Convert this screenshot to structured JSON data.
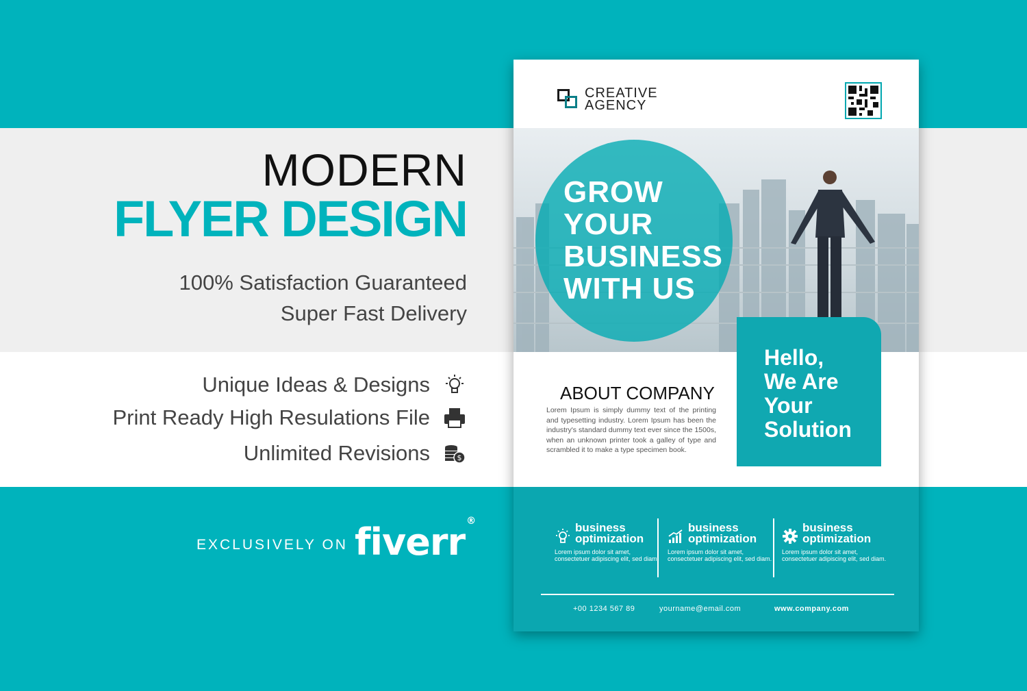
{
  "headline": {
    "line1": "MODERN",
    "line2": "FLYER DESIGN",
    "sub1": "100% Satisfaction Guaranteed",
    "sub2": "Super Fast Delivery"
  },
  "features": [
    {
      "label": "Unique Ideas & Designs",
      "icon": "lightbulb-icon"
    },
    {
      "label": "Print Ready High Resulations File",
      "icon": "printer-icon"
    },
    {
      "label": "Unlimited Revisions",
      "icon": "coins-icon"
    }
  ],
  "exclusive": {
    "label": "EXCLUSIVELY ON",
    "brand": "fiverr",
    "reg": "®"
  },
  "flyer": {
    "logo_line1": "CREATIVE",
    "logo_line2": "AGENCY",
    "grow": [
      "GROW",
      "YOUR",
      "BUSINESS",
      "WITH US"
    ],
    "hello": [
      "Hello,",
      "We Are",
      "Your",
      "Solution"
    ],
    "about_title": "ABOUT COMPANY",
    "about_text": "Lorem Ipsum is simply dummy text of the printing and typesetting industry. Lorem Ipsum has been the industry's standard dummy text ever since the 1500s, when an unknown printer took a galley of type and scrambled it to make a type specimen book.",
    "columns": [
      {
        "line1": "business",
        "line2": "optimization",
        "desc": "Lorem ipsum dolor sit amet, consectetuer adipiscing elit, sed diam.",
        "icon": "lightbulb-icon"
      },
      {
        "line1": "business",
        "line2": "optimization",
        "desc": "Lorem ipsum dolor sit amet, consectetuer adipiscing elit, sed diam.",
        "icon": "bar-chart-icon"
      },
      {
        "line1": "business",
        "line2": "optimization",
        "desc": "Lorem ipsum dolor sit amet, consectetuer adipiscing elit, sed diam.",
        "icon": "gear-icon"
      }
    ],
    "phone": "+00 1234 567 89",
    "email": "yourname@email.com",
    "web": "www.company.com"
  },
  "colors": {
    "teal": "#00b3bc",
    "flyer_teal": "#0ba7b0",
    "grey_band": "#efefef"
  }
}
